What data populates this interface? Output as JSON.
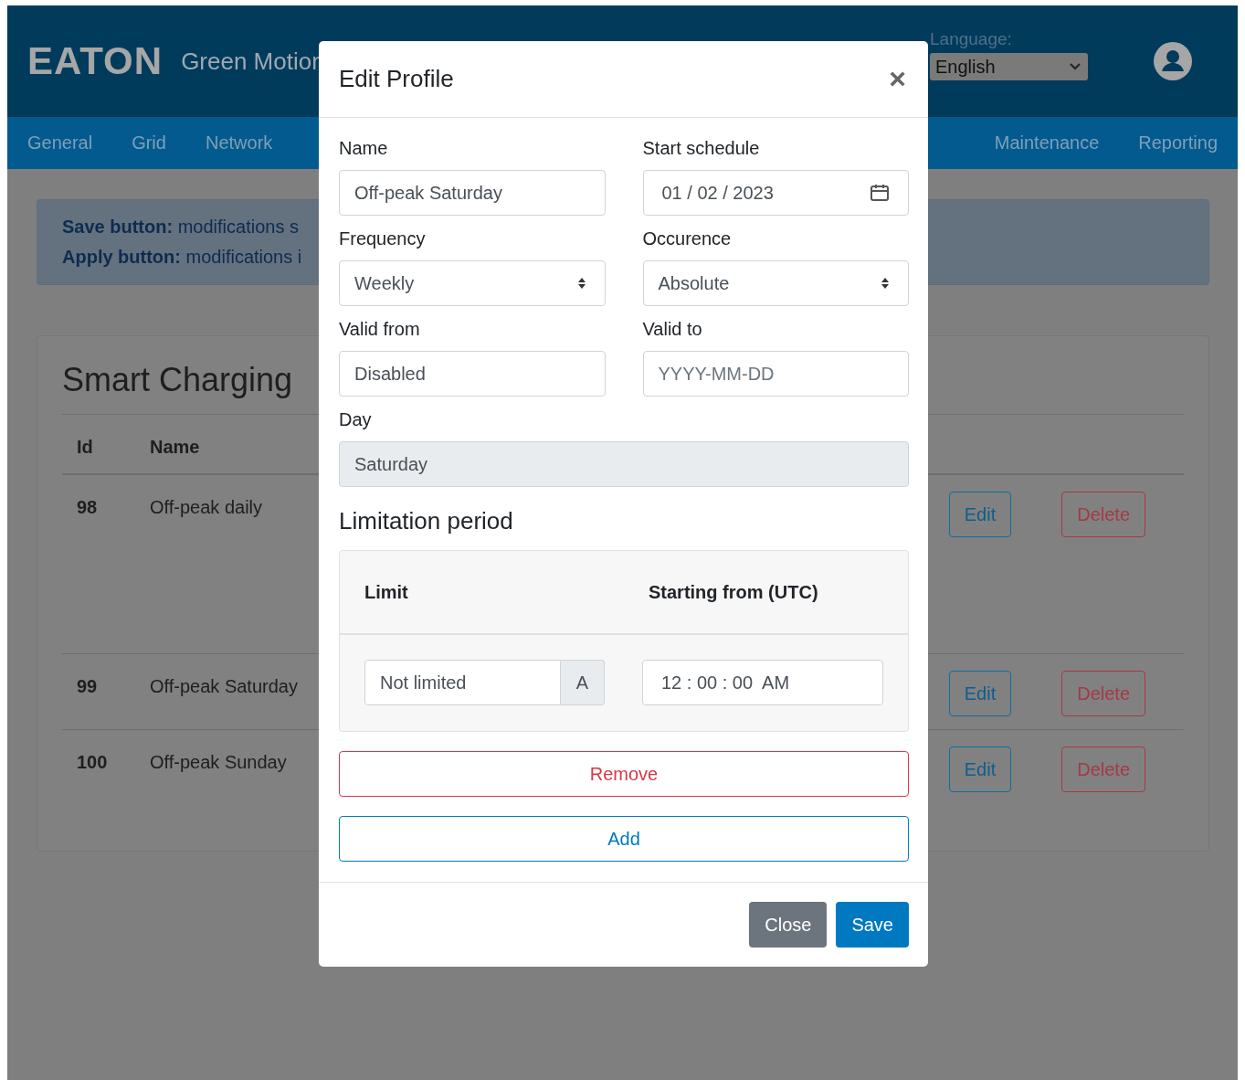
{
  "header": {
    "logo": "EATON",
    "app_name": "Green Motion",
    "language": {
      "label": "Language:",
      "value": "English"
    }
  },
  "nav": {
    "left": [
      {
        "label": "General"
      },
      {
        "label": "Grid"
      },
      {
        "label": "Network"
      }
    ],
    "right": [
      {
        "label": "Maintenance"
      },
      {
        "label": "Reporting"
      }
    ]
  },
  "alert": {
    "lines": [
      "**Save button:** modifications s",
      "**Apply button:** modifications i"
    ]
  },
  "card": {
    "title": "Smart Charging",
    "columns": [
      "Id",
      "Name"
    ],
    "rows": [
      {
        "id": "98",
        "name": "Off-peak daily",
        "edit": "Edit",
        "delete": "Delete"
      },
      {
        "id": "99",
        "name": "Off-peak Saturday",
        "edit": "Edit",
        "delete": "Delete"
      },
      {
        "id": "100",
        "name": "Off-peak Sunday",
        "edit": "Edit",
        "delete": "Delete"
      }
    ]
  },
  "modal": {
    "title": "Edit Profile",
    "close": "×",
    "fields": [
      {
        "label": "Name",
        "kind": "text",
        "value": "Off-peak Saturday"
      },
      {
        "label": "Start schedule",
        "kind": "date",
        "value": "01 / 02 / 2023"
      },
      {
        "label": "Frequency",
        "kind": "select",
        "value": "Weekly"
      },
      {
        "label": "Occurence",
        "kind": "select",
        "value": "Absolute"
      },
      {
        "label": "Valid from",
        "kind": "text",
        "value": "Disabled"
      },
      {
        "label": "Valid to",
        "kind": "text",
        "placeholder": "YYYY-MM-DD"
      }
    ],
    "day": {
      "label": "Day",
      "value": "Saturday",
      "disabled": true
    },
    "section_title": "Limitation period",
    "limits": {
      "columns": [
        "Limit",
        "Starting from (UTC)"
      ],
      "rows": [
        {
          "limit": "Not limited",
          "unit": "A",
          "start": "12 : 00 : 00  AM"
        }
      ]
    },
    "remove": "Remove",
    "add": "Add",
    "buttons": [
      {
        "label": "Close",
        "kind": "secondary"
      },
      {
        "label": "Save",
        "kind": "primary"
      }
    ]
  }
}
